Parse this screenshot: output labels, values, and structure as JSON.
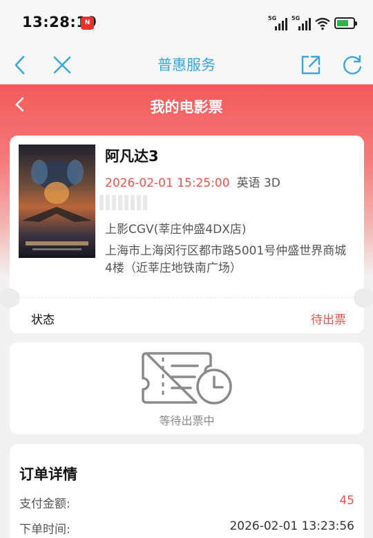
{
  "status_bar": {
    "time": "13:28:19",
    "app_badge": "N",
    "signal_1": "5G",
    "signal_2": "5G"
  },
  "nav": {
    "title": "普惠服务",
    "back_icon": "chevron-left-icon",
    "close_icon": "close-icon",
    "share_icon": "share-external-icon",
    "refresh_icon": "refresh-icon"
  },
  "page": {
    "title": "我的电影票"
  },
  "ticket": {
    "movie_title": "阿凡达3",
    "show_time": "2026-02-01 15:25:00",
    "language_format": "英语 3D",
    "cinema": "上影CGV(莘庄仲盛4DX店)",
    "address": "上海市上海闵行区都市路5001号仲盛世界商城4楼（近莘庄地铁南广场）",
    "status_label": "状态",
    "status_value": "待出票"
  },
  "waiting": {
    "text": "等待出票中",
    "icon": "ticket-clock-icon"
  },
  "order": {
    "title": "订单详情",
    "rows": [
      {
        "key": "支付金额:",
        "value": "45"
      },
      {
        "key": "下单时间:",
        "value": "2026-02-01 13:23:56"
      }
    ]
  },
  "colors": {
    "accent_red": "#e8544e",
    "nav_blue": "#3aa6d9",
    "hero_top": "#f35a5a"
  }
}
